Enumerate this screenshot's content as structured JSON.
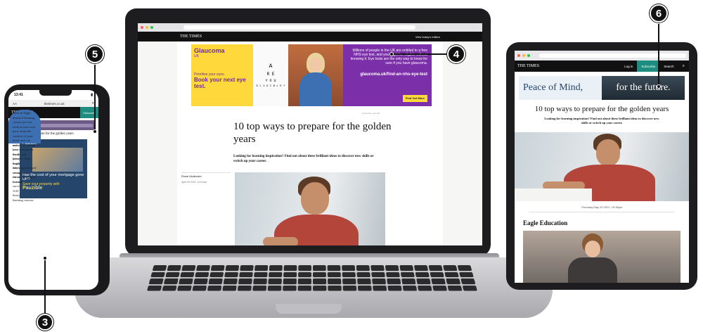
{
  "laptop": {
    "site_logo": "THE TIMES",
    "edition_link": "View today's edition",
    "ad": {
      "brand": "Glaucoma",
      "brand_sub": "UK",
      "tagline1": "Prioritise your eyes.",
      "tagline2": "Book your next eye test.",
      "chart_rows": [
        "A",
        "R E",
        "Y O U",
        "E L I G I B L E ?"
      ],
      "body": "Millions of people in the UK are entitled to a free NHS eye test, and you might be eligible without knowing it. Eye tests are the only way to know for sure if you have glaucoma.",
      "url": "glaucoma.uk/find-an-nhs-eye-test",
      "button": "Find Out More"
    },
    "sponsor_note": "Hosted by yourself",
    "title": "10 top ways to prepare for the golden years",
    "intro": "Looking for learning inspiration? Find out about these brilliant ideas to discover new skills or switch up your career.",
    "author": "Rosie Mullender",
    "date": "April 30 2022, 12:01am"
  },
  "phone": {
    "time": "13:41",
    "text_size": "AA",
    "url": "thetimes.co.uk",
    "site_logo": "THE TIMES",
    "subscribe": "Subscribe",
    "headline": "10 top ways to prepare for the golden years",
    "para1": "If you're considering a career change, this stable and rewarding career could be the key to a brighter future and a job you love. Eagle makes the learning process easy. For nearly 20 years they've built a strong reputation for supporting learners to succeed with their AAT qualification through flexible learning courses.",
    "mpu": {
      "logo": "Pauzible",
      "question": "Has the cost of your mortgage gone UP?",
      "save_line": "Save your property with",
      "brand": "Pauzible"
    },
    "para2": "With an Eagle distance-learning course you can work at your own pace, from the comfort of your home and can make it fit around your current job, family and lifestyle. With Eagle's subscription based courses, you choose how much to study"
  },
  "tablet": {
    "site_logo": "THE TIMES",
    "login": "Log in",
    "subscribe": "Subscribe",
    "search": "Search",
    "ad": {
      "left": "Peace of Mind,",
      "right": "for the future."
    },
    "title": "10 top ways to prepare for the golden years",
    "intro": "Looking for learning inspiration? Find out about these brilliant ideas to discover new skills or switch up your career.",
    "date": "Thursday May 20 2021, 15:38pm",
    "section": "Eagle Education"
  },
  "callouts": {
    "c3": "3",
    "c4": "4",
    "c5": "5",
    "c6": "6"
  },
  "colors": {
    "times_black": "#111111",
    "subscribe_teal": "#1c8d7e",
    "glaucoma_purple": "#7b2fa8",
    "glaucoma_yellow": "#ffd93b"
  }
}
